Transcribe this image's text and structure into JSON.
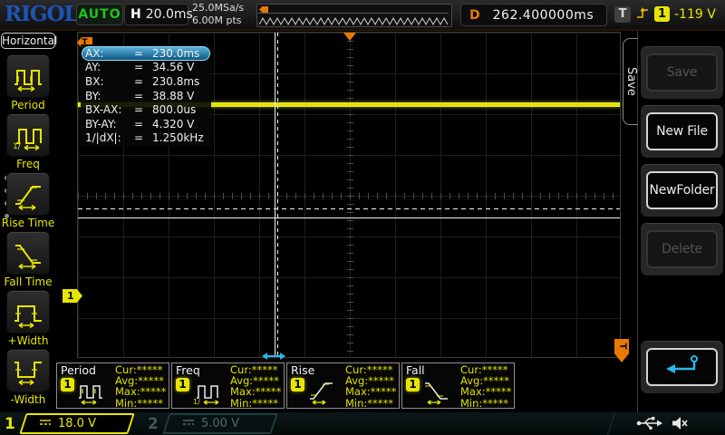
{
  "colors": {
    "channel1_yellow": "#e6e600",
    "trigger_orange": "#e87800",
    "logo_blue": "#1c55b8",
    "auto_green": "#1ec41e",
    "cursor_cyan": "#28b8e8",
    "highlight_blue": "#2f8fc0"
  },
  "top_bar": {
    "logo": "RIGOL",
    "trigger_status": "AUTO",
    "horizontal_label": "H",
    "timebase": "20.0ms",
    "sample_rate": "25.0MSa/s",
    "memory_depth": "6.00M pts",
    "delay_label": "D",
    "delay_value": "262.400000ms",
    "trigger_label": "T",
    "trigger_channel": "1",
    "trigger_level": "-119 V"
  },
  "left_menu": {
    "title": "Horizontal",
    "items": [
      {
        "label": "Period"
      },
      {
        "label": "Freq"
      },
      {
        "label": "Rise Time"
      },
      {
        "label": "Fall Time"
      },
      {
        "label": "+Width"
      },
      {
        "label": "-Width"
      }
    ]
  },
  "cursor_panel": {
    "equals": "=",
    "rows": [
      {
        "label": "AX:",
        "value": "230.0ms"
      },
      {
        "label": "AY:",
        "value": "34.56 V"
      },
      {
        "label": "BX:",
        "value": "230.8ms"
      },
      {
        "label": "BY:",
        "value": "38.88 V"
      },
      {
        "label": "BX-AX:",
        "value": "800.0us"
      },
      {
        "label": "BY-AY:",
        "value": "4.320 V"
      },
      {
        "label": "1/|dX|:",
        "value": "1.250kHz"
      }
    ]
  },
  "grid": {
    "trigger_position_marker": "T",
    "trigger_level_marker": "T",
    "channel_marker": "1"
  },
  "right_menu": {
    "tab": "Save",
    "buttons": {
      "save": {
        "label": "Save",
        "enabled": false
      },
      "new_file": {
        "label": "New File",
        "enabled": true
      },
      "new_folder": {
        "label": "NewFolder",
        "enabled": true
      },
      "delete": {
        "label": "Delete",
        "enabled": false
      }
    }
  },
  "icons": {
    "freq_prefix": "1/"
  },
  "measurements": [
    {
      "name": "Period",
      "channel": "1",
      "stats": [
        "Cur:*****",
        "Avg:*****",
        "Max:*****",
        "Min:*****"
      ]
    },
    {
      "name": "Freq",
      "channel": "1",
      "stats": [
        "Cur:*****",
        "Avg:*****",
        "Max:*****",
        "Min:*****"
      ]
    },
    {
      "name": "Rise",
      "channel": "1",
      "stats": [
        "Cur:*****",
        "Avg:*****",
        "Max:*****",
        "Min:*****"
      ]
    },
    {
      "name": "Fall",
      "channel": "1",
      "stats": [
        "Cur:*****",
        "Avg:*****",
        "Max:*****",
        "Min:*****"
      ]
    }
  ],
  "bottom_bar": {
    "ch1": {
      "number": "1",
      "scale": "18.0 V"
    },
    "ch2": {
      "number": "2",
      "scale": "5.00 V"
    }
  }
}
